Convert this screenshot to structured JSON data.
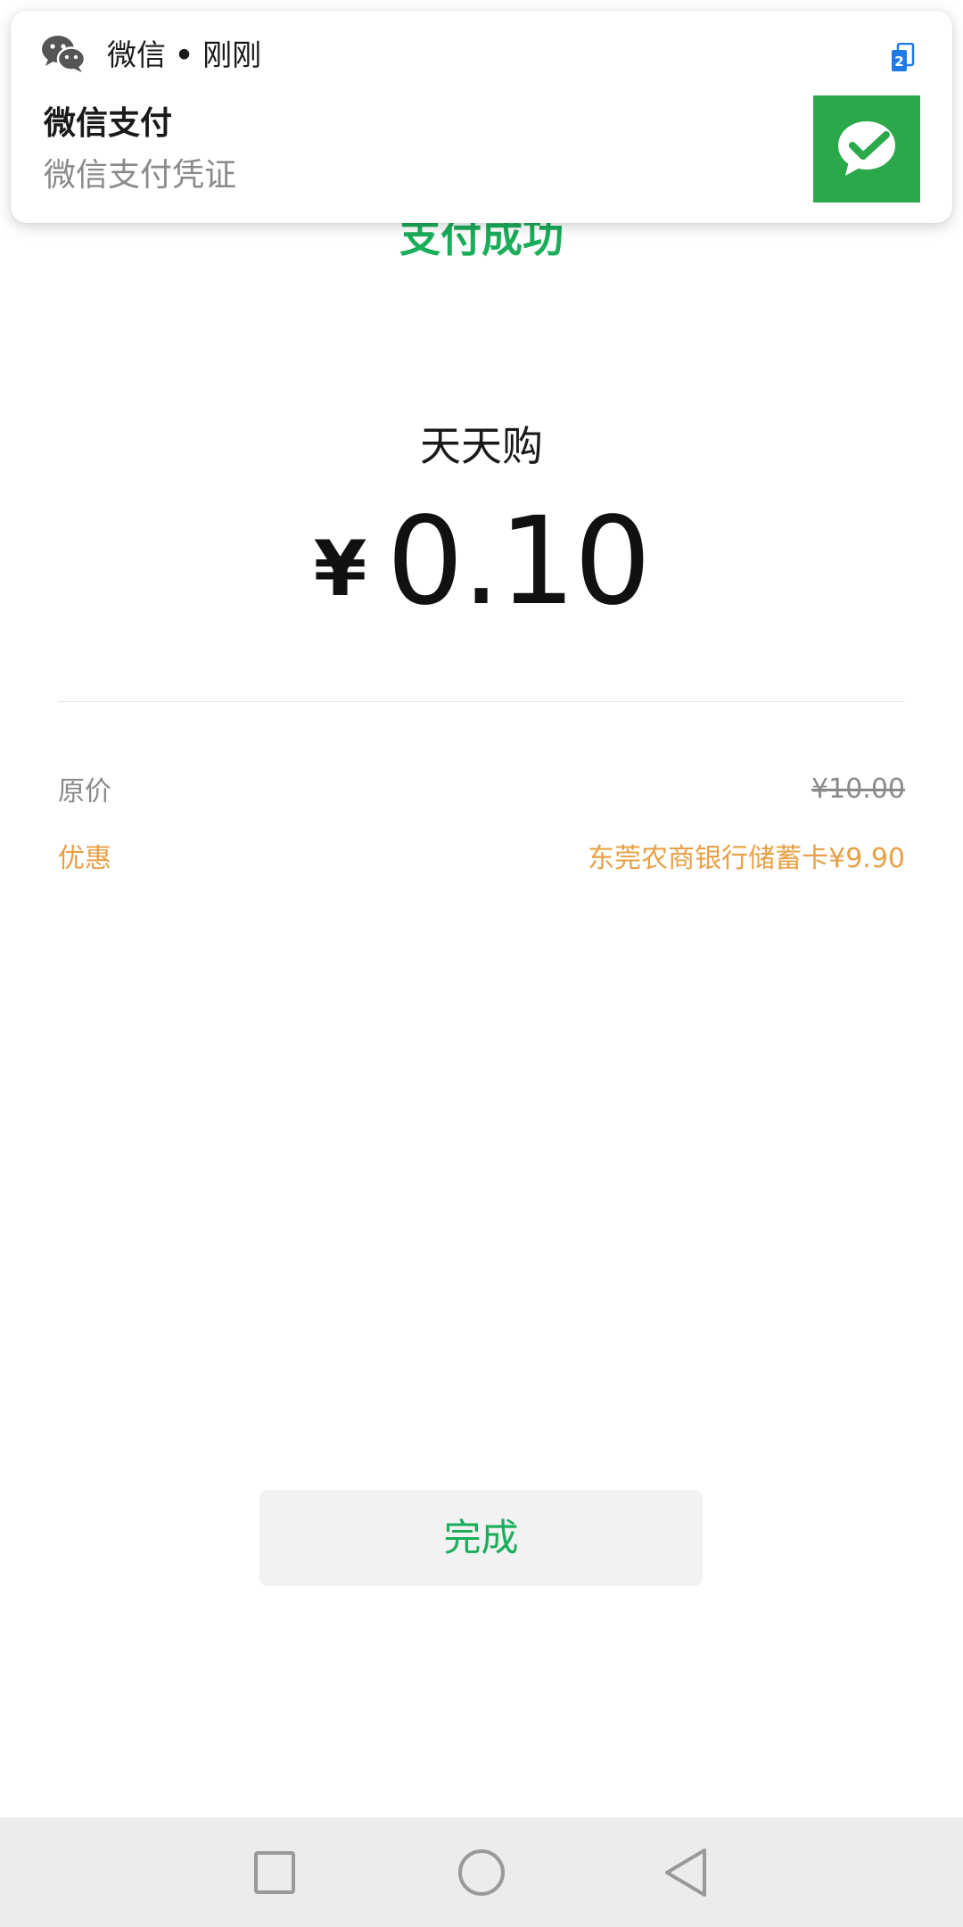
{
  "notification": {
    "app_name": "微信",
    "separator": "•",
    "time": "刚刚",
    "title": "微信支付",
    "text": "微信支付凭证",
    "badge_count": "2",
    "icons": {
      "app": "wechat-icon",
      "badge": "stacked-notifications-icon",
      "thumbnail": "wechat-pay-check-icon"
    },
    "colors": {
      "thumbnail_bg": "#2aa84a",
      "badge": "#1e7be6"
    }
  },
  "payment": {
    "status_title": "支付成功",
    "merchant": "天天购",
    "currency_symbol": "¥",
    "amount": "0.10"
  },
  "details": {
    "original_price_label": "原价",
    "original_price_value": "¥10.00",
    "discount_label": "优惠",
    "discount_value": "东莞农商银行储蓄卡¥9.90"
  },
  "actions": {
    "done_label": "完成"
  },
  "nav_bar": {
    "icons": [
      "square-recent-apps-icon",
      "circle-home-icon",
      "triangle-back-icon"
    ]
  },
  "colors": {
    "accent_green": "#1aad5a",
    "discount_orange": "#e8a046",
    "secondary_gray": "#8a8a8a"
  }
}
